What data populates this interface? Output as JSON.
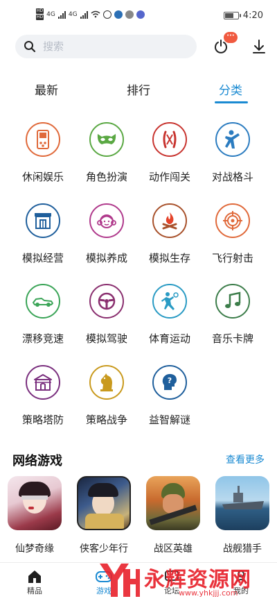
{
  "status_bar": {
    "net_label_1": "4G",
    "net_label_2": "4G",
    "hd_label": "HD",
    "time": "4:20"
  },
  "search": {
    "placeholder": "搜索"
  },
  "header": {
    "badge_text": "···"
  },
  "tabs": [
    {
      "label": "最新"
    },
    {
      "label": "排行"
    },
    {
      "label": "分类"
    }
  ],
  "categories": [
    {
      "label": "休闲娱乐",
      "icon": "gameboy-icon",
      "color": "#e0693a"
    },
    {
      "label": "角色扮演",
      "icon": "mask-icon",
      "color": "#5aa843"
    },
    {
      "label": "动作闯关",
      "icon": "swords-icon",
      "color": "#c8342f"
    },
    {
      "label": "对战格斗",
      "icon": "fighter-icon",
      "color": "#2b7cc0"
    },
    {
      "label": "模拟经营",
      "icon": "shop-icon",
      "color": "#1f5f9c"
    },
    {
      "label": "模拟养成",
      "icon": "girl-face-icon",
      "color": "#b03a8c"
    },
    {
      "label": "模拟生存",
      "icon": "campfire-icon",
      "color": "#a8512b"
    },
    {
      "label": "飞行射击",
      "icon": "crosshair-icon",
      "color": "#e0693a"
    },
    {
      "label": "漂移竞速",
      "icon": "race-car-icon",
      "color": "#3aa457"
    },
    {
      "label": "模拟驾驶",
      "icon": "steering-wheel-icon",
      "color": "#8a2f6f"
    },
    {
      "label": "体育运动",
      "icon": "tennis-player-icon",
      "color": "#2a9bc4"
    },
    {
      "label": "音乐卡牌",
      "icon": "music-note-icon",
      "color": "#3c7d4a"
    },
    {
      "label": "策略塔防",
      "icon": "fortress-icon",
      "color": "#7a2f7e"
    },
    {
      "label": "策略战争",
      "icon": "chess-knight-icon",
      "color": "#c99a1e"
    },
    {
      "label": "益智解谜",
      "icon": "puzzle-head-icon",
      "color": "#1f5f9c"
    }
  ],
  "online_games": {
    "title": "网络游戏",
    "more_label": "查看更多",
    "items": [
      {
        "name": "仙梦奇缘"
      },
      {
        "name": "侠客少年行"
      },
      {
        "name": "战区英雄"
      },
      {
        "name": "战舰猎手"
      }
    ]
  },
  "bottom_nav": [
    {
      "label": "精品",
      "icon": "home-icon"
    },
    {
      "label": "游戏",
      "icon": "gamepad-icon"
    },
    {
      "label": "论坛",
      "icon": "forum-icon"
    },
    {
      "label": "我的",
      "icon": "profile-icon"
    }
  ],
  "watermark": {
    "text": "永辉资源网",
    "url": "www.yhkjjj.com"
  },
  "colors": {
    "accent": "#1a8ad2",
    "badge": "#f05a40"
  }
}
